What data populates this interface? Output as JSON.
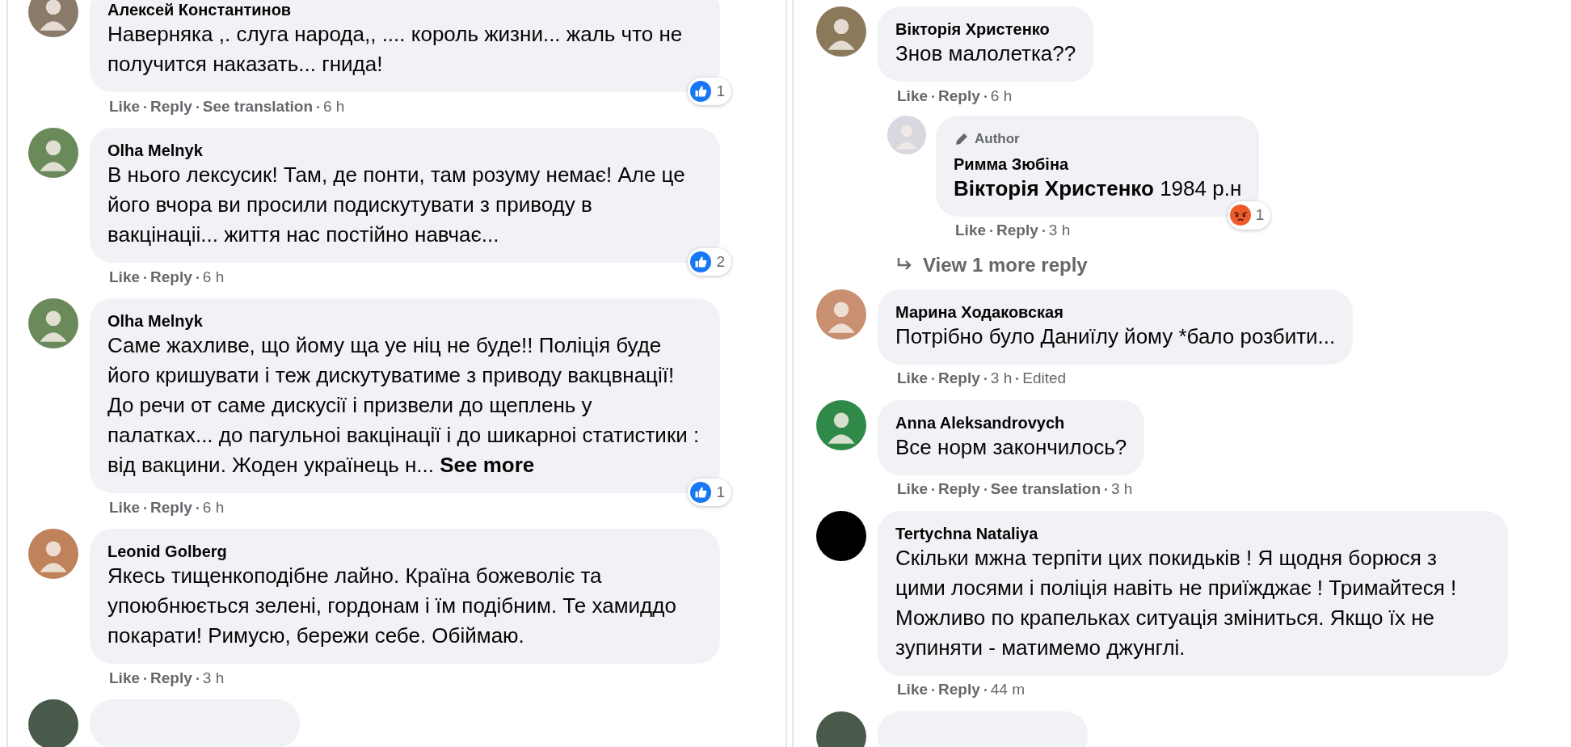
{
  "columns": [
    {
      "comments": [
        {
          "author": "Алексей Константинов",
          "color": "#8a7a6a",
          "text": "Наверняка ,. слуга народа,, .... король жизни... жаль что не получится наказать... гнида!",
          "actions": [
            "Like",
            "Reply",
            "See translation"
          ],
          "time": "6 h",
          "reaction": {
            "kind": "like",
            "count": "1"
          }
        },
        {
          "author": "Olha Melnyk",
          "color": "#6b8a5a",
          "text": "В нього лексусик! Там, де понти, там розуму немає! Але це його вчора ви просили подискутувати з приводу в вакцінаціі... життя нас постійно навчає...",
          "actions": [
            "Like",
            "Reply"
          ],
          "time": "6 h",
          "reaction": {
            "kind": "like",
            "count": "2"
          }
        },
        {
          "author": "Olha Melnyk",
          "color": "#6b8a5a",
          "text": "Саме жахливе, що йому ща уе ніц не буде!! Поліція буде його кришувати і теж дискутуватиме з приводу вакцвнації! До речи от саме дискусії і призвели до щеплень у палатках... до пагульноі вакцінації і до шикарноі статистики : від вакцини. Жоден українець н...",
          "see_more": "See more",
          "actions": [
            "Like",
            "Reply"
          ],
          "time": "6 h",
          "reaction": {
            "kind": "like",
            "count": "1"
          }
        },
        {
          "author": "Leonid Golberg",
          "color": "#c0825a",
          "text": "Якесь тищенкоподібне лайно. Країна божеволіє та упоюбнюється зелені, гордонам і їм подібним. Те хамиддо покарати! Римусю, бережи себе. Обіймаю.",
          "actions": [
            "Like",
            "Reply"
          ],
          "time": "3 h"
        }
      ],
      "cut_off_comment": true
    },
    {
      "comments": [
        {
          "author": "Вікторія Христенко",
          "color": "#8a7a5a",
          "text": "Знов малолетка??",
          "actions": [
            "Like",
            "Reply"
          ],
          "time": "6 h",
          "replies": [
            {
              "author": "Римма Зюбіна",
              "color": "#d8d8e0",
              "badge": "Author",
              "text": "**Вікторія Христенко** 1984 р.н",
              "actions": [
                "Like",
                "Reply"
              ],
              "time": "3 h",
              "reaction": {
                "kind": "angry",
                "count": "1"
              }
            }
          ],
          "more_replies": "View 1 more reply"
        },
        {
          "author": "Марина Ходаковская",
          "color": "#c89070",
          "text": "Потрібно було Даниїлу йому *бало розбити...",
          "actions": [
            "Like",
            "Reply"
          ],
          "time": "3 h",
          "edited": "Edited"
        },
        {
          "author": "Anna Aleksandrovych",
          "color": "#2f8a4a",
          "text": "Все норм закончилось?",
          "actions": [
            "Like",
            "Reply",
            "See translation"
          ],
          "time": "3 h"
        },
        {
          "author": "Tertychna Nataliya",
          "color": "#000000",
          "text": "Скільки мжна терпіти цих покидьків ! Я щодня борюся з цими лосями і поліція навіть не приїжджає ! Тримайтеся ! Можливо по крапельках ситуація зміниться. Якщо їх не зупиняти - матимемо джунглі.",
          "actions": [
            "Like",
            "Reply"
          ],
          "time": "44 m"
        }
      ],
      "cut_off_comment": true
    }
  ]
}
